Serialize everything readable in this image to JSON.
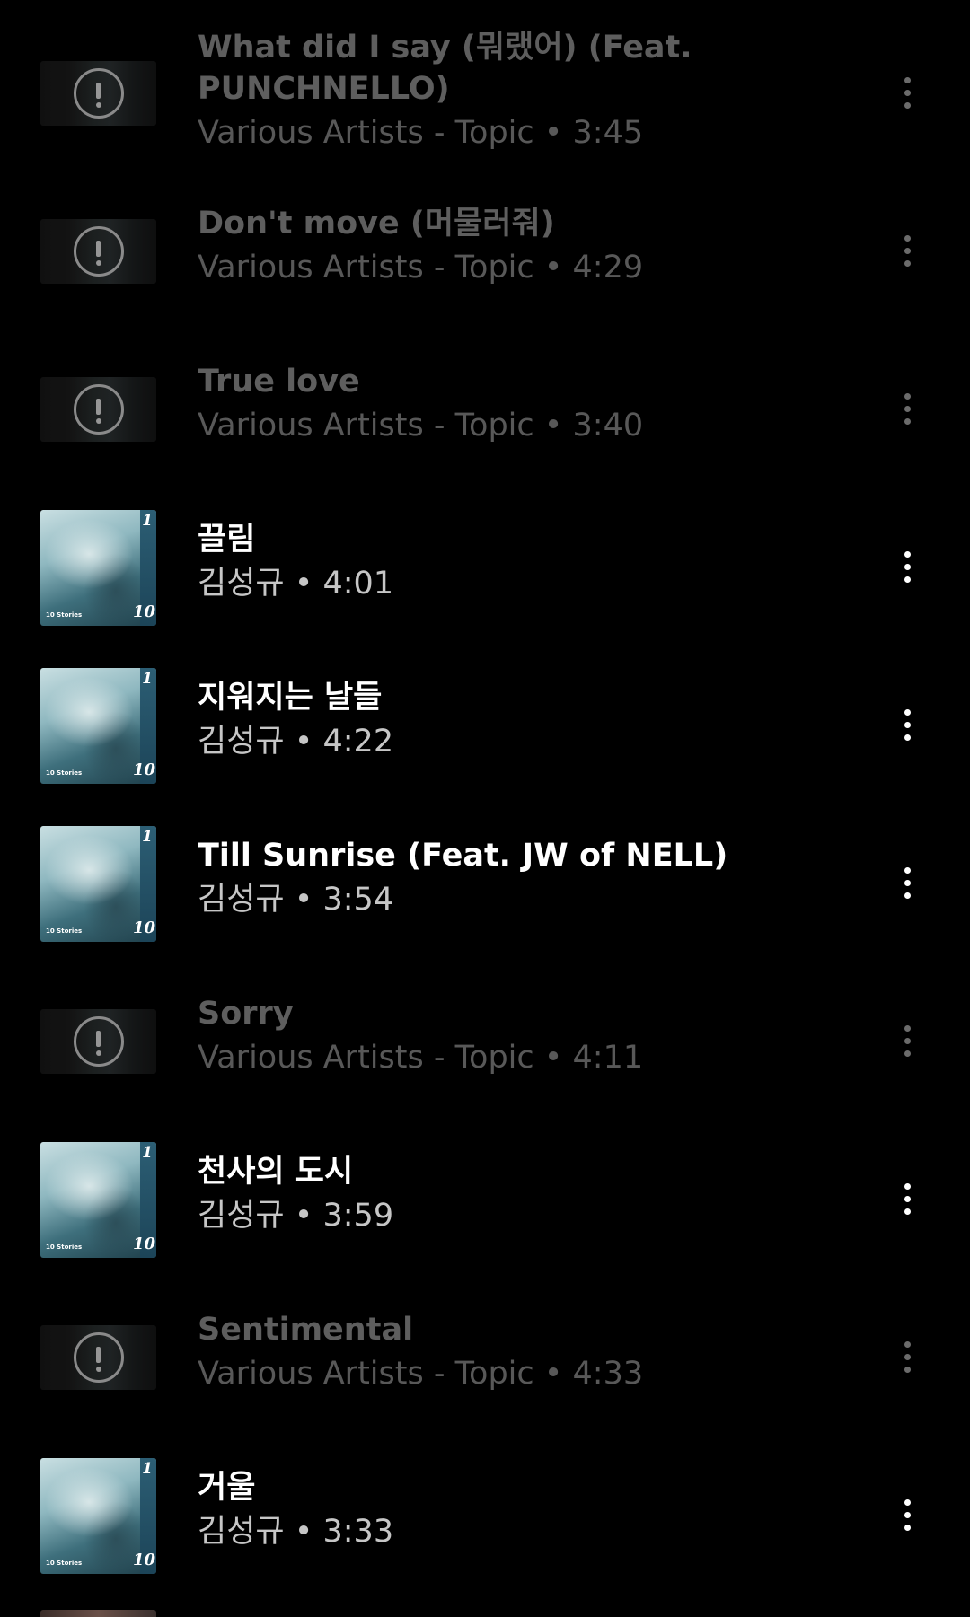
{
  "tracks": [
    {
      "title": "What did I say (뭐랬어) (Feat. PUNCHNELLO)",
      "subtitle": "Various Artists - Topic • 3:45",
      "available": false
    },
    {
      "title": "Don't move (머물러줘)",
      "subtitle": "Various Artists - Topic • 4:29",
      "available": false
    },
    {
      "title": "True love",
      "subtitle": "Various Artists - Topic • 3:40",
      "available": false
    },
    {
      "title": "끌림",
      "subtitle": "김성규 • 4:01",
      "available": true
    },
    {
      "title": "지워지는 날들",
      "subtitle": "김성규 • 4:22",
      "available": true
    },
    {
      "title": "Till Sunrise (Feat. JW of NELL)",
      "subtitle": "김성규 • 3:54",
      "available": true
    },
    {
      "title": "Sorry",
      "subtitle": "Various Artists - Topic • 4:11",
      "available": false
    },
    {
      "title": "천사의 도시",
      "subtitle": "김성규 • 3:59",
      "available": true
    },
    {
      "title": "Sentimental",
      "subtitle": "Various Artists - Topic • 4:33",
      "available": false
    },
    {
      "title": "거울",
      "subtitle": "김성규 • 3:33",
      "available": true
    }
  ],
  "cover_art": {
    "corner_top": "1",
    "corner_bottom": "10",
    "caption": "10 Stories"
  },
  "icons": {
    "unavailable": "alert-circle-icon",
    "menu": "more-vert-icon"
  },
  "colors": {
    "background": "#000000",
    "title": "#ffffff",
    "subtitle": "#c6c6c6",
    "disabled_text": "#5e5e5e"
  }
}
